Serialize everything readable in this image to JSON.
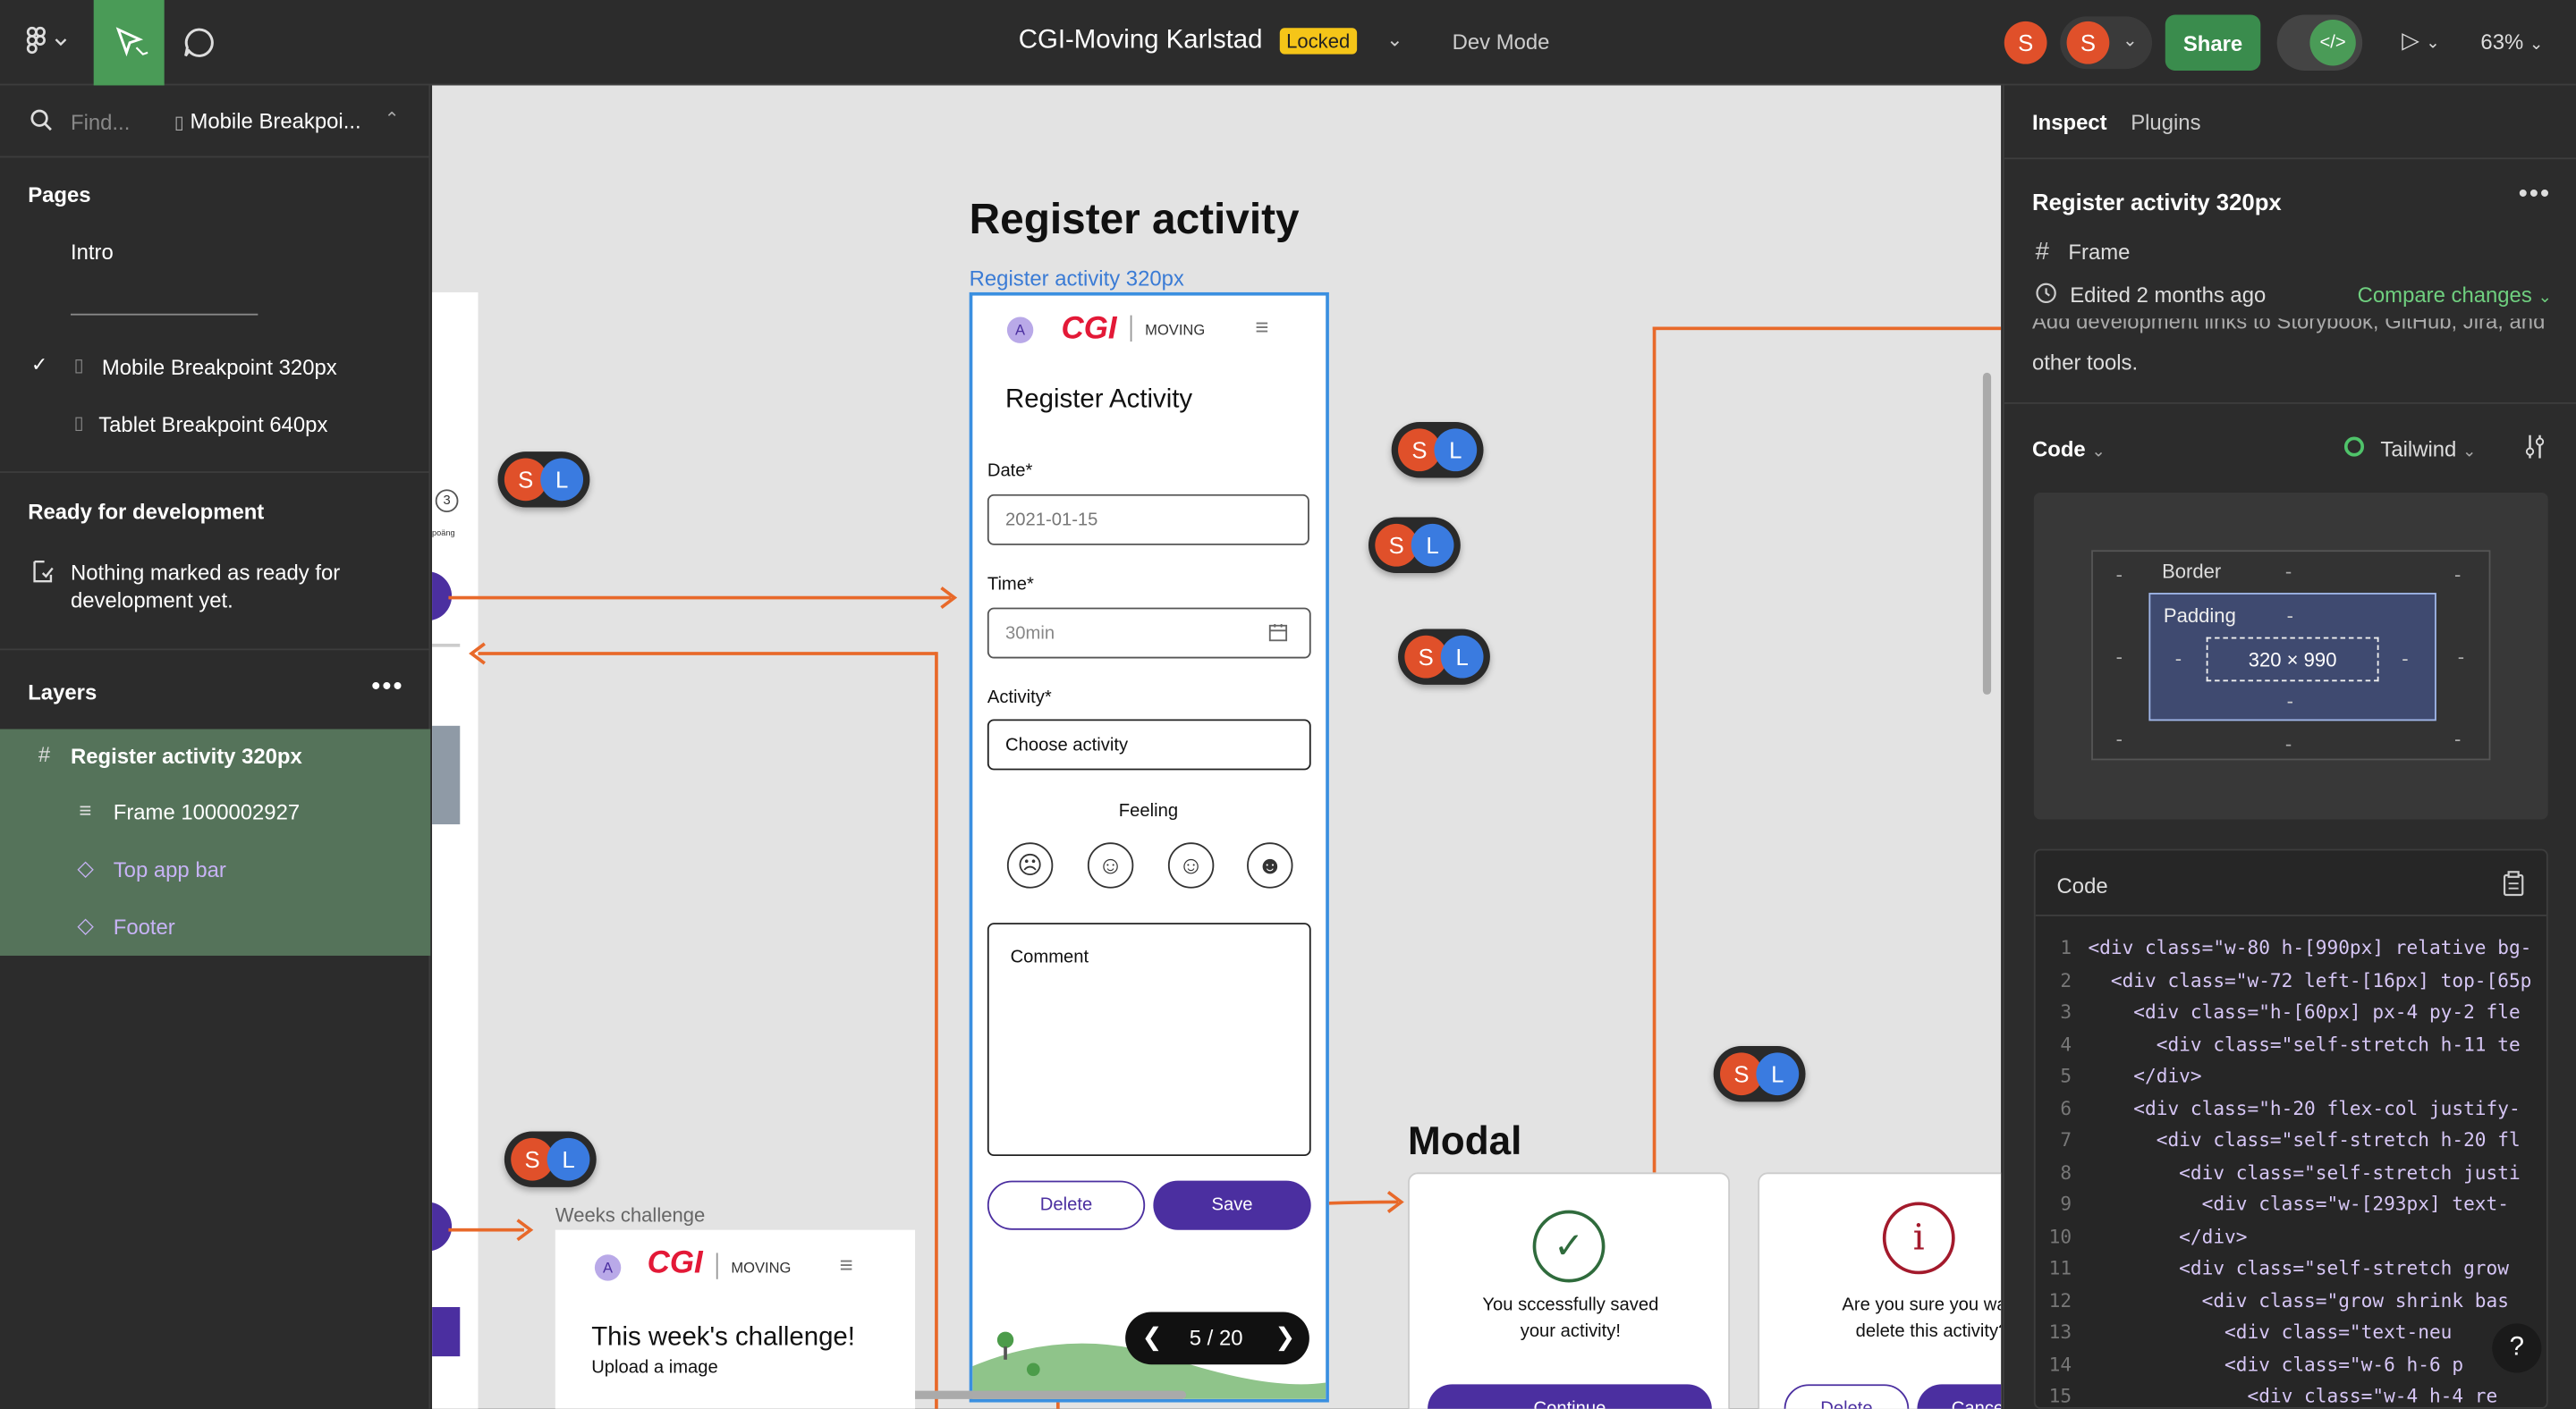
{
  "topbar": {
    "title": "CGI-Moving Karlstad",
    "locked": "Locked",
    "dev_mode": "Dev Mode",
    "avatar1": "S",
    "avatar2": "S",
    "share": "Share",
    "zoom": "63%"
  },
  "left": {
    "search_placeholder": "Find...",
    "current_page": "Mobile Breakpoi...",
    "pages_heading": "Pages",
    "pages": [
      "Intro",
      "Mobile Breakpoint 320px",
      "Tablet Breakpoint 640px"
    ],
    "ready_heading": "Ready for development",
    "ready_text1": "Nothing marked as ready for",
    "ready_text2": "development yet.",
    "layers_heading": "Layers",
    "layers": [
      "Register activity 320px",
      "Frame 1000002927",
      "Top app bar",
      "Footer"
    ]
  },
  "canvas": {
    "section_title": "Register activity",
    "frame_label": "Register activity 320px",
    "phone": {
      "avatar": "A",
      "logo": "CGI",
      "moving": "MOVING",
      "heading": "Register Activity",
      "date_label": "Date*",
      "date_value": "2021-01-15",
      "time_label": "Time*",
      "time_placeholder": "30min",
      "activity_label": "Activity*",
      "activity_value": "Choose activity",
      "feeling_label": "Feeling",
      "comment_placeholder": "Comment",
      "delete": "Delete",
      "save": "Save"
    },
    "pager": "5 / 20",
    "collab_s": "S",
    "collab_l": "L",
    "weeks_label": "Weeks challenge",
    "weeks": {
      "avatar": "A",
      "logo": "CGI",
      "moving": "MOVING",
      "heading": "This week's challenge!",
      "sub": "Upload a image"
    },
    "modal_title": "Modal",
    "modal1_text1": "You sccessfully saved",
    "modal1_text2": "your activity!",
    "modal1_btn": "Continue",
    "modal2_text1": "Are you sure you want",
    "modal2_text2": "delete this activity?",
    "modal2_btn1": "Delete",
    "modal2_btn2": "Cancel",
    "stepper_num": "3",
    "small_text": "poäng"
  },
  "right": {
    "tab_inspect": "Inspect",
    "tab_plugins": "Plugins",
    "frame_name": "Register activity 320px",
    "frame_type": "Frame",
    "edited": "Edited 2 months ago",
    "compare": "Compare changes",
    "cut_text1": "Add development links to Storybook, GitHub, Jira, and",
    "cut_text2": "other tools.",
    "code_heading": "Code",
    "framework": "Tailwind",
    "box_border": "Border",
    "box_padding": "Padding",
    "box_size": "320 × 990",
    "dash": "-",
    "code_block_heading": "Code",
    "code_lines": [
      {
        "n": "1",
        "text": "<div class=\"w-80 h-[990px] relative bg-"
      },
      {
        "n": "2",
        "text": "  <div class=\"w-72 left-[16px] top-[65p"
      },
      {
        "n": "3",
        "text": "    <div class=\"h-[60px] px-4 py-2 fle"
      },
      {
        "n": "4",
        "text": "      <div class=\"self-stretch h-11 te"
      },
      {
        "n": "5",
        "text": "    </div>"
      },
      {
        "n": "6",
        "text": "    <div class=\"h-20 flex-col justify-"
      },
      {
        "n": "7",
        "text": "      <div class=\"self-stretch h-20 fl"
      },
      {
        "n": "8",
        "text": "        <div class=\"self-stretch justi"
      },
      {
        "n": "9",
        "text": "          <div class=\"w-[293px] text-"
      },
      {
        "n": "10",
        "text": "        </div>"
      },
      {
        "n": "11",
        "text": "        <div class=\"self-stretch grow"
      },
      {
        "n": "12",
        "text": "          <div class=\"grow shrink bas"
      },
      {
        "n": "13",
        "text": "            <div class=\"text-neu"
      },
      {
        "n": "14",
        "text": "            <div class=\"w-6 h-6 p"
      },
      {
        "n": "15",
        "text": "              <div class=\"w-4 h-4 re"
      }
    ],
    "help": "?"
  },
  "colors": {
    "accent_green": "#4a9b57",
    "primary_purple": "#4b2fa0",
    "cgi_red": "#e31937",
    "connector_orange": "#e8692a"
  }
}
